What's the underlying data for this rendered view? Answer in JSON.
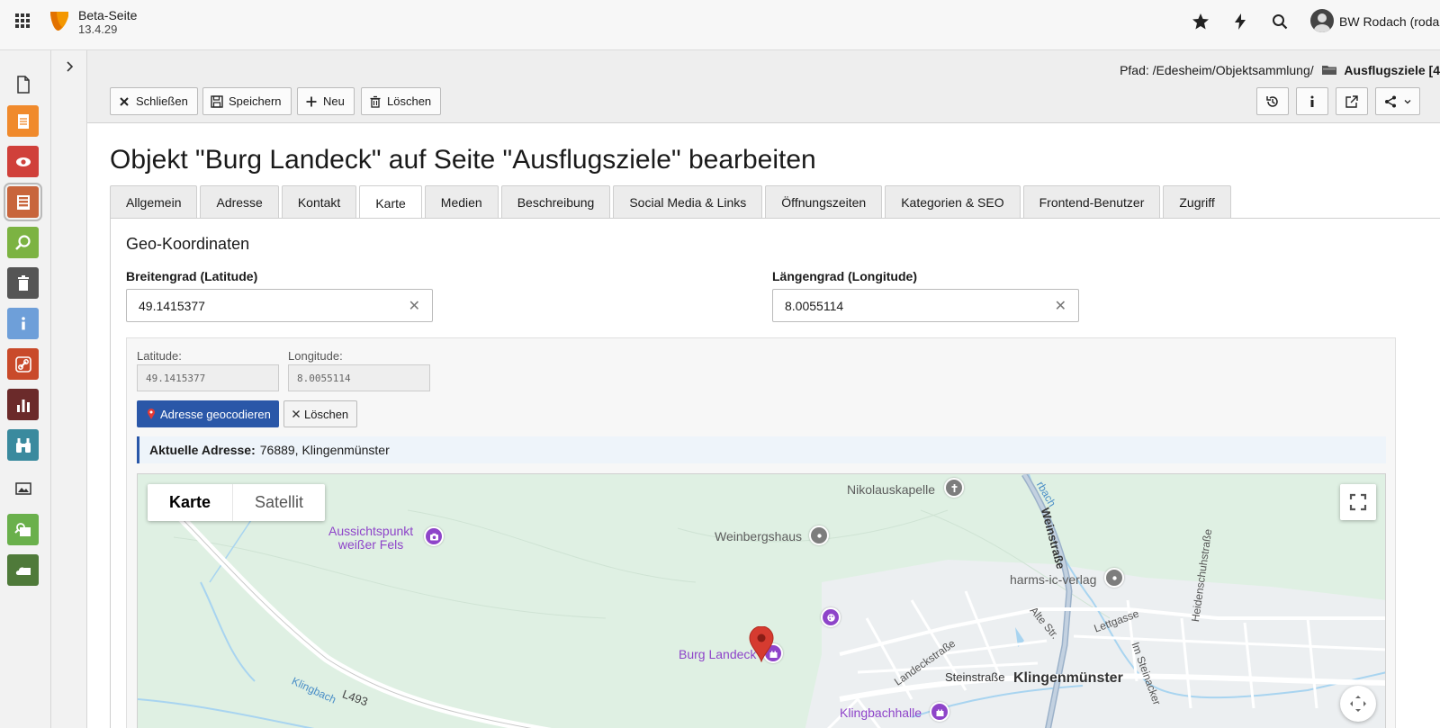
{
  "topbar": {
    "site_name": "Beta-Seite",
    "site_version": "13.4.29",
    "user_name": "BW Rodach (roda"
  },
  "docheader": {
    "path_prefix": "Pfad: /Edesheim/Objektsammlung/",
    "path_current": "Ausflugsziele [4",
    "buttons": {
      "close": "Schließen",
      "save": "Speichern",
      "new": "Neu",
      "delete": "Löschen"
    }
  },
  "page": {
    "title": "Objekt \"Burg Landeck\" auf Seite \"Ausflugsziele\" bearbeiten",
    "tabs": [
      {
        "label": "Allgemein"
      },
      {
        "label": "Adresse"
      },
      {
        "label": "Kontakt"
      },
      {
        "label": "Karte",
        "active": true
      },
      {
        "label": "Medien"
      },
      {
        "label": "Beschreibung"
      },
      {
        "label": "Social Media & Links"
      },
      {
        "label": "Öffnungszeiten"
      },
      {
        "label": "Kategorien & SEO"
      },
      {
        "label": "Frontend-Benutzer"
      },
      {
        "label": "Zugriff"
      }
    ]
  },
  "geo": {
    "section_title": "Geo-Koordinaten",
    "latitude_label": "Breitengrad (Latitude)",
    "latitude_value": "49.1415377",
    "longitude_label": "Längengrad (Longitude)",
    "longitude_value": "8.0055114"
  },
  "map_widget": {
    "lat_label": "Latitude:",
    "lat_value": "49.1415377",
    "lng_label": "Longitude:",
    "lng_value": "8.0055114",
    "geocode_button": "Adresse geocodieren",
    "clear_button": "Löschen",
    "address_label": "Aktuelle Adresse:",
    "address_value": "76889, Klingenmünster"
  },
  "map": {
    "type_map": "Karte",
    "type_satellite": "Satellit",
    "pois": {
      "nikolauskapelle": "Nikolauskapelle",
      "aussichtspunkt_1": "Aussichtspunkt",
      "aussichtspunkt_2": "weißer Fels",
      "weinbergshaus": "Weinbergshaus",
      "harms": "harms-ic-verlag",
      "burg_landeck": "Burg Landeck",
      "klingbachhalle": "Klingbachhalle"
    },
    "streets": {
      "weinstrasse": "Weinstraße",
      "alte_str": "Alte Str.",
      "lettgasse": "Lettgasse",
      "landeckstrasse": "Landeckstraße",
      "steinstrasse": "Steinstraße",
      "im_steinacker": "Im Steinacker",
      "heidenschuhstrasse": "Heidenschuhstraße",
      "klingbach": "Klingbach",
      "l493": "L493",
      "bach": "rbach"
    },
    "town": "Klingenmünster",
    "colors": {
      "marker": "#d63b30",
      "poi_purple": "#8e44c9",
      "poi_grey": "#7d7d7d",
      "park": "#dff0e3",
      "water": "#a8d4f0"
    }
  }
}
